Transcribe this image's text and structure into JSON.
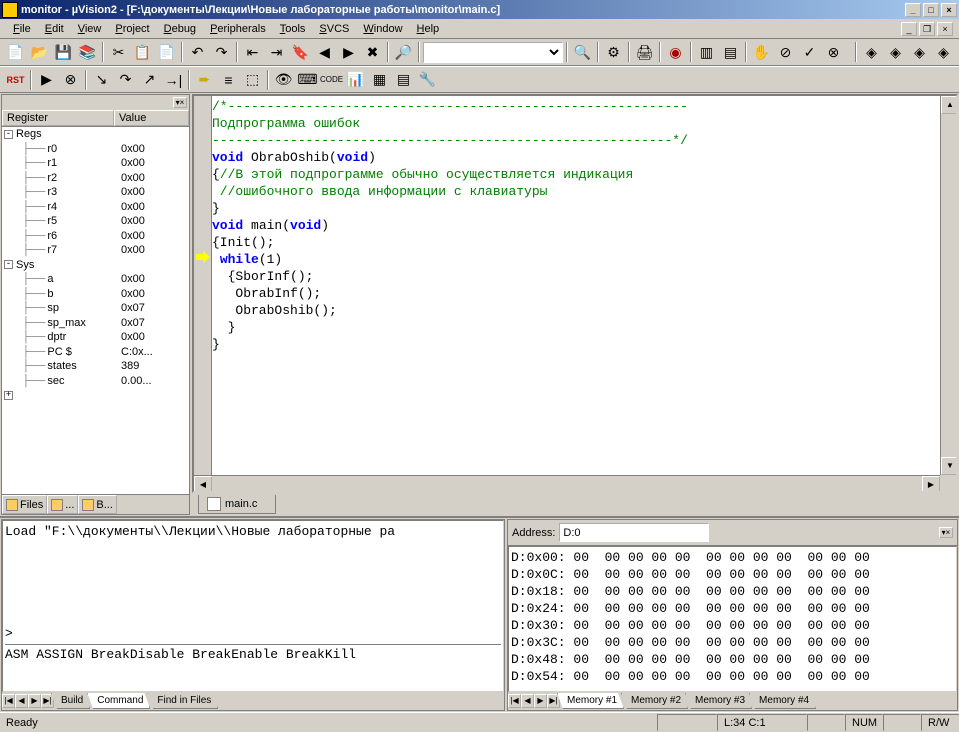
{
  "title": "monitor  - µVision2 - [F:\\документы\\Лекции\\Новые лабораторные работы\\monitor\\main.c]",
  "menus": [
    "File",
    "Edit",
    "View",
    "Project",
    "Debug",
    "Peripherals",
    "Tools",
    "SVCS",
    "Window",
    "Help"
  ],
  "toolbar1_combo": "",
  "register_headers": {
    "reg": "Register",
    "val": "Value"
  },
  "registers": [
    {
      "type": "group",
      "name": "Regs",
      "exp": "-"
    },
    {
      "type": "reg",
      "name": "r0",
      "val": "0x00"
    },
    {
      "type": "reg",
      "name": "r1",
      "val": "0x00"
    },
    {
      "type": "reg",
      "name": "r2",
      "val": "0x00"
    },
    {
      "type": "reg",
      "name": "r3",
      "val": "0x00"
    },
    {
      "type": "reg",
      "name": "r4",
      "val": "0x00"
    },
    {
      "type": "reg",
      "name": "r5",
      "val": "0x00"
    },
    {
      "type": "reg",
      "name": "r6",
      "val": "0x00"
    },
    {
      "type": "reg",
      "name": "r7",
      "val": "0x00"
    },
    {
      "type": "group",
      "name": "Sys",
      "exp": "-"
    },
    {
      "type": "reg",
      "name": "a",
      "val": "0x00"
    },
    {
      "type": "reg",
      "name": "b",
      "val": "0x00"
    },
    {
      "type": "reg",
      "name": "sp",
      "val": "0x07"
    },
    {
      "type": "reg",
      "name": "sp_max",
      "val": "0x07"
    },
    {
      "type": "reg",
      "name": "dptr",
      "val": "0x00"
    },
    {
      "type": "reg",
      "name": "PC $",
      "val": "C:0x..."
    },
    {
      "type": "reg",
      "name": "states",
      "val": "389"
    },
    {
      "type": "reg",
      "name": "sec",
      "val": "0.00..."
    },
    {
      "type": "group",
      "name": "",
      "exp": "+",
      "partial": true
    }
  ],
  "project_tabs": [
    "Files",
    "...",
    "B..."
  ],
  "code_lines": [
    {
      "cls": "cm",
      "txt": "/*-----------------------------------------------------------"
    },
    {
      "cls": "cm",
      "txt": "Подпрограмма ошибок"
    },
    {
      "cls": "cm",
      "txt": "-----------------------------------------------------------*/"
    },
    {
      "cls": "",
      "pre": "void",
      "mid": " ObrabOshib(",
      "post": "void",
      "tail": ")"
    },
    {
      "cls": "cm2",
      "txt": "{//В этой подпрограмме обычно осуществляется индикация"
    },
    {
      "cls": "cm",
      "txt": " //ошибочного ввода информации с клавиатуры"
    },
    {
      "cls": "",
      "txt": "}"
    },
    {
      "cls": "",
      "txt": ""
    },
    {
      "cls": "",
      "pre": "void",
      "mid": " main(",
      "post": "void",
      "tail": ")"
    },
    {
      "cls": "",
      "txt": "{Init();",
      "arrow": true
    },
    {
      "cls": "wh",
      "pre": " while",
      "txt": "(1)"
    },
    {
      "cls": "",
      "txt": "  {SborInf();"
    },
    {
      "cls": "",
      "txt": "   ObrabInf();"
    },
    {
      "cls": "",
      "txt": "   ObrabOshib();"
    },
    {
      "cls": "",
      "txt": "  }"
    },
    {
      "cls": "",
      "txt": "}"
    }
  ],
  "file_tab": "main.c",
  "output": {
    "line1": "Load \"F:\\\\документы\\\\Лекции\\\\Новые лабораторные ра",
    "prompt": ">",
    "hint": "ASM ASSIGN BreakDisable BreakEnable BreakKill"
  },
  "output_tabs": [
    "Build",
    "Command",
    "Find in Files"
  ],
  "output_active_tab": 1,
  "memory": {
    "addr_label": "Address:",
    "addr_value": "D:0",
    "rows": [
      "D:0x00: 00  00 00 00 00  00 00 00 00  00 00 00",
      "D:0x0C: 00  00 00 00 00  00 00 00 00  00 00 00",
      "D:0x18: 00  00 00 00 00  00 00 00 00  00 00 00",
      "D:0x24: 00  00 00 00 00  00 00 00 00  00 00 00",
      "D:0x30: 00  00 00 00 00  00 00 00 00  00 00 00",
      "D:0x3C: 00  00 00 00 00  00 00 00 00  00 00 00",
      "D:0x48: 00  00 00 00 00  00 00 00 00  00 00 00",
      "D:0x54: 00  00 00 00 00  00 00 00 00  00 00 00"
    ],
    "tabs": [
      "Memory #1",
      "Memory #2",
      "Memory #3",
      "Memory #4"
    ]
  },
  "status": {
    "ready": "Ready",
    "pos": "L:34 C:1",
    "num": "NUM",
    "rw": "R/W"
  }
}
